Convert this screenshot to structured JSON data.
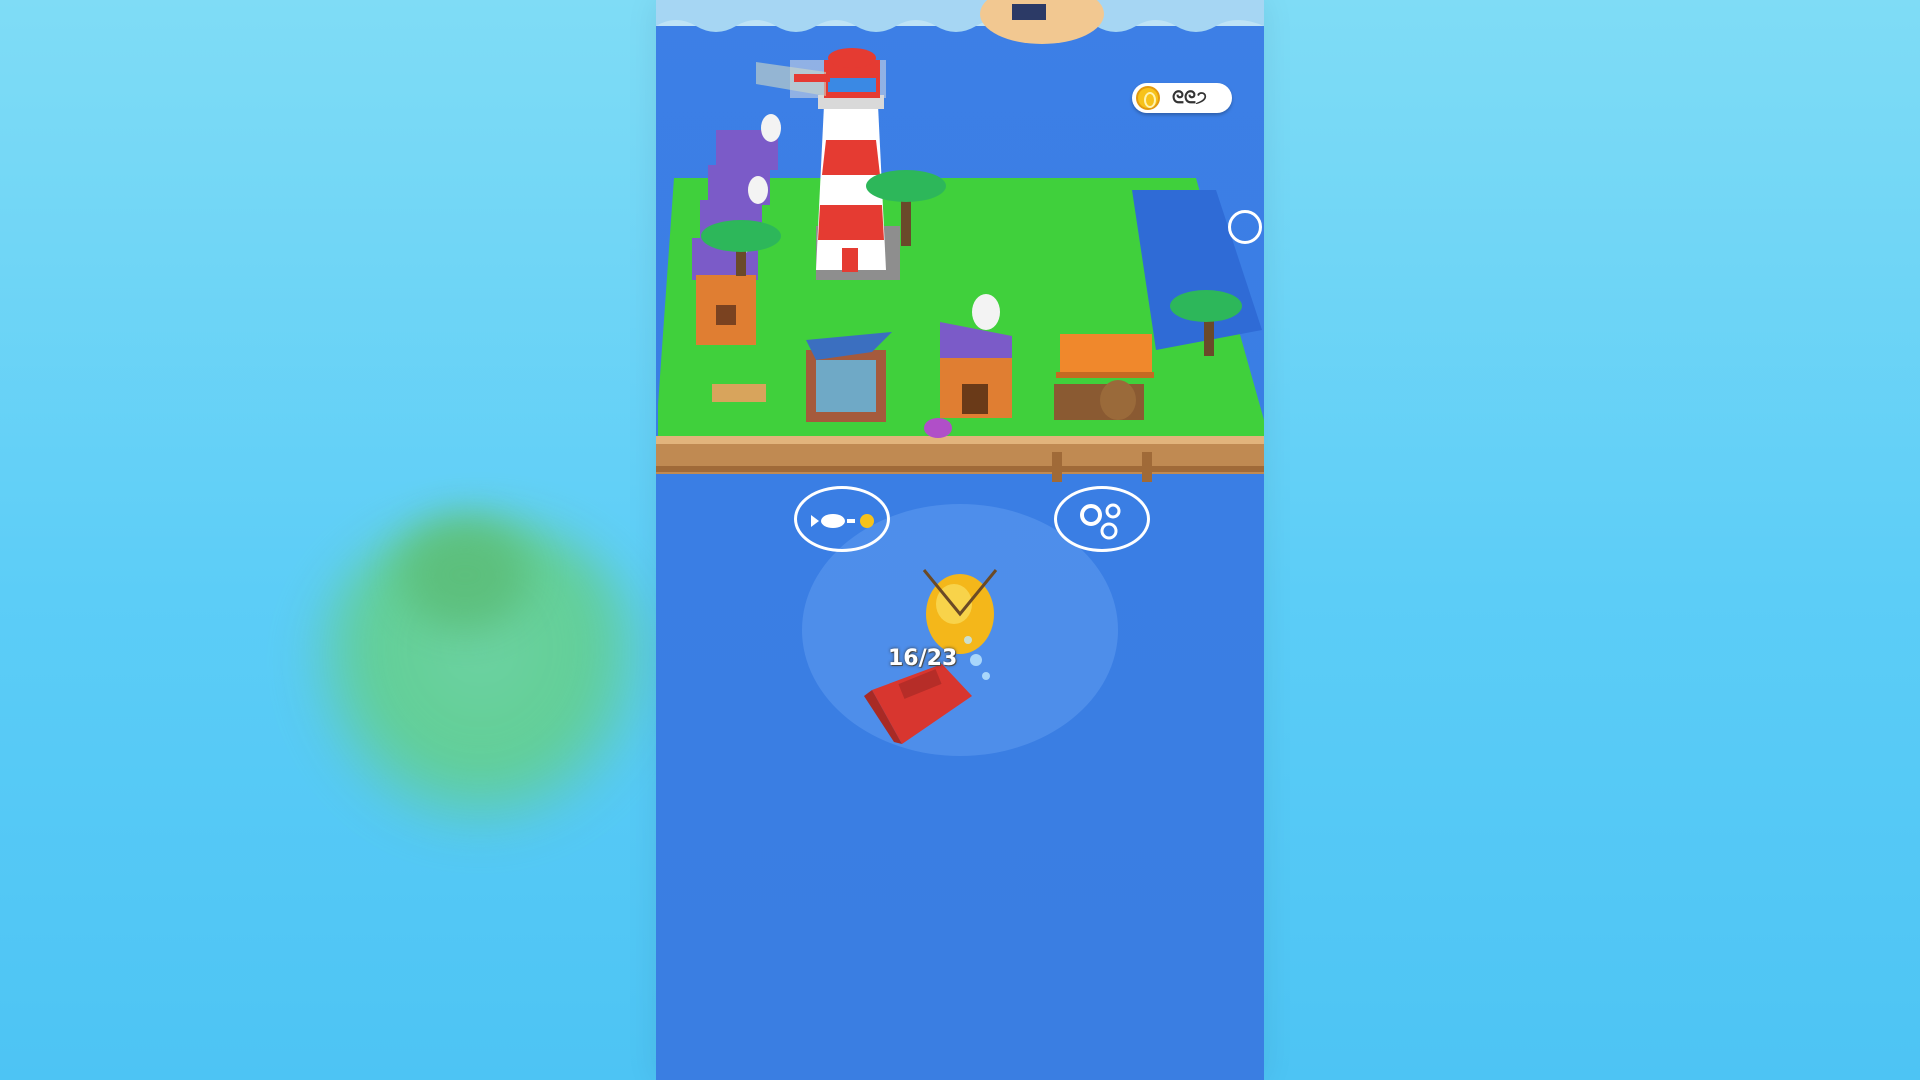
{
  "hud": {
    "coins": "ᘓᘓ੭",
    "cargo_count": "16/23"
  },
  "icons": {
    "coin": "coin-icon",
    "sell_fish": "fish-to-coin-icon",
    "upgrade": "gears-icon"
  },
  "colors": {
    "ocean": "#3a7ee4",
    "grass": "#3dd93a",
    "lighthouse_red": "#e53b32",
    "boat_red": "#d8362f",
    "coin": "#f7c21a"
  }
}
